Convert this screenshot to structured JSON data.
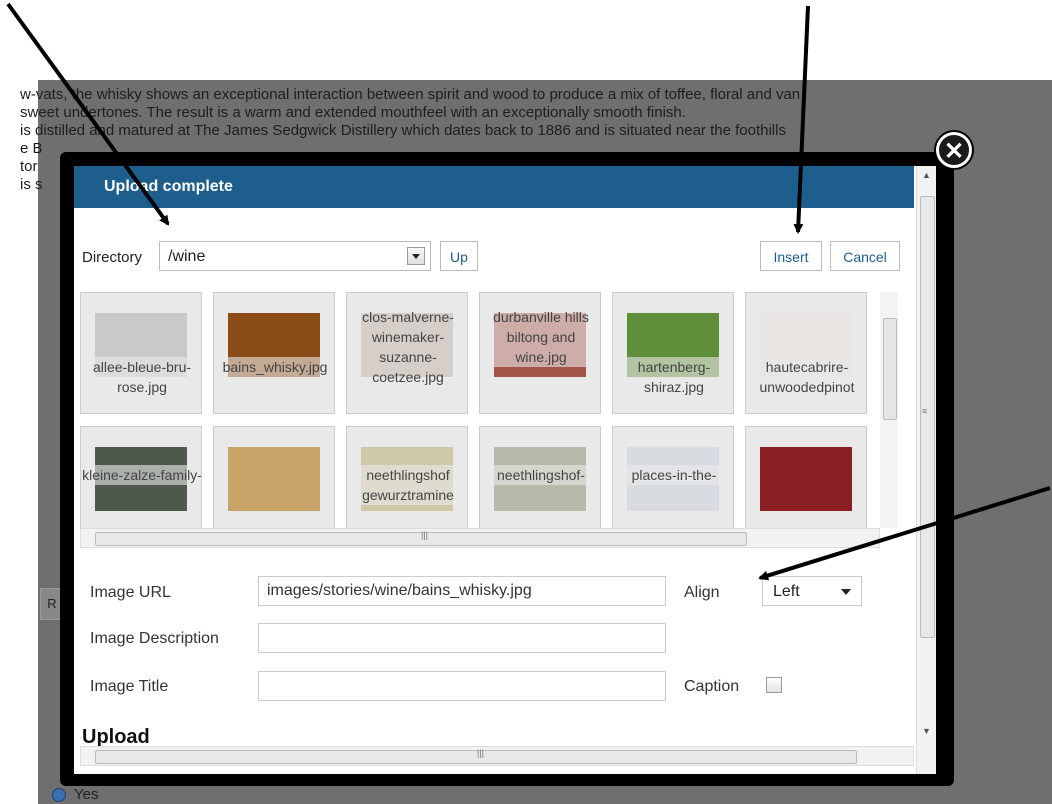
{
  "background": {
    "text_lines": [
      "w-vats, the whisky shows an exceptional interaction between spirit and wood to produce a mix of toffee, floral and van",
      "   sweet undertones. The result is a warm and extended mouthfeel with an exceptionally smooth finish.",
      "is distilled and matured at The James Sedgwick Distillery which dates back to 1886 and is situated near the foothills",
      "e B",
      "tor",
      "is s"
    ],
    "yes_label": "Yes",
    "partial_button": "R"
  },
  "dialog": {
    "title": "Upload complete",
    "close_glyph": "✕",
    "directory_label": "Directory",
    "directory_value": "/wine",
    "up_label": "Up",
    "insert_label": "Insert",
    "cancel_label": "Cancel",
    "thumbnails": [
      {
        "caption": "allee-bleue-bru-rose.jpg",
        "icon": "wine-bottle-label-icon",
        "color": "#c9c9c9"
      },
      {
        "caption": "bains_whisky.jpg",
        "icon": "whisky-glass-icon",
        "color": "#8a4b17"
      },
      {
        "caption": "clos-malverne-winemaker-suzanne-coetzee.jpg",
        "icon": "winemaker-photo-icon",
        "color": "#b9a79a"
      },
      {
        "caption": "durbanville hills biltong and wine.jpg",
        "icon": "biltong-wine-photo-icon",
        "color": "#a5544a"
      },
      {
        "caption": "hartenberg-shiraz.jpg",
        "icon": "vineyard-photo-icon",
        "color": "#5f8f3a"
      },
      {
        "caption": "hautecabrire-unwoodedpinot",
        "icon": "wine-bottle-icon",
        "color": "#e8e4e2"
      },
      {
        "caption": "kleine-zalze-family-",
        "icon": "wine-bottles-photo-icon",
        "color": "#4d5a4b"
      },
      {
        "caption": "",
        "icon": "champagne-glasses-icon",
        "color": "#c8a469"
      },
      {
        "caption": "neethlingshof gewurztramine",
        "icon": "wine-bottle-photo-icon",
        "color": "#cfc9a8"
      },
      {
        "caption": "neethlingshof-",
        "icon": "wine-labels-photo-icon",
        "color": "#b9b9a9"
      },
      {
        "caption": "places-in-the-",
        "icon": "wine-glass-photo-icon",
        "color": "#d8dbe0"
      },
      {
        "caption": "",
        "icon": "two-wine-bottles-icon",
        "color": "#8a1f23"
      }
    ],
    "image_url_label": "Image URL",
    "image_url_value": "images/stories/wine/bains_whisky.jpg",
    "align_label": "Align",
    "align_value": "Left",
    "image_description_label": "Image Description",
    "image_description_value": "",
    "image_title_label": "Image Title",
    "image_title_value": "",
    "caption_label": "Caption",
    "upload_heading": "Upload"
  },
  "colors": {
    "header": "#1d5e8c",
    "frame": "#000000",
    "overlay": "#6f6f6f"
  }
}
